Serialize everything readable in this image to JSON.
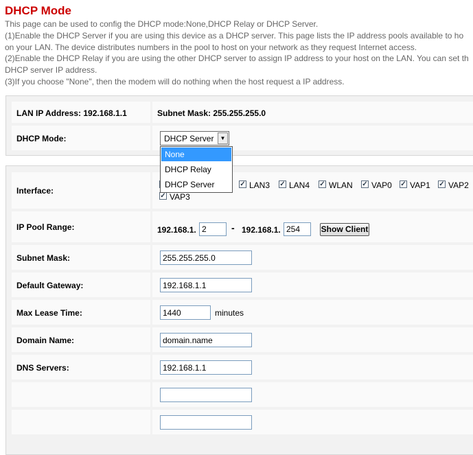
{
  "page": {
    "title": "DHCP Mode",
    "description": [
      "This page can be used to config the DHCP mode:None,DHCP Relay or DHCP Server.",
      "(1)Enable the DHCP Server if you are using this device as a DHCP server. This page lists the IP address pools available to ho",
      "on your LAN. The device distributes numbers in the pool to host on your network as they request Internet access.",
      "(2)Enable the DHCP Relay if you are using the other DHCP server to assign IP address to your host on the LAN. You can set th",
      "DHCP server IP address.",
      "(3)If you choose \"None\", then the modem will do nothing when the host request a IP address."
    ]
  },
  "lan": {
    "ip_label": "LAN IP Address: 192.168.1.1",
    "mask_label": "Subnet Mask: 255.255.255.0"
  },
  "dhcp_mode": {
    "label": "DHCP Mode:",
    "selected": "DHCP Server",
    "options": [
      "None",
      "DHCP Relay",
      "DHCP Server"
    ],
    "highlighted": "None"
  },
  "interface": {
    "label": "Interface:",
    "items": [
      "LAN3",
      "LAN4",
      "WLAN",
      "VAP0",
      "VAP1",
      "VAP2",
      "VAP3"
    ]
  },
  "ip_pool": {
    "label": "IP Pool Range:",
    "prefix": "192.168.1.",
    "dash": "-",
    "start": "2",
    "end": "254",
    "show_client": "Show Client"
  },
  "subnet_mask": {
    "label": "Subnet Mask:",
    "value": "255.255.255.0"
  },
  "default_gateway": {
    "label": "Default Gateway:",
    "value": "192.168.1.1"
  },
  "max_lease": {
    "label": "Max Lease Time:",
    "value": "1440",
    "unit": "minutes"
  },
  "domain_name": {
    "label": "Domain Name:",
    "value": "domain.name"
  },
  "dns": {
    "label": "DNS Servers:",
    "values": [
      "192.168.1.1",
      "",
      ""
    ]
  }
}
